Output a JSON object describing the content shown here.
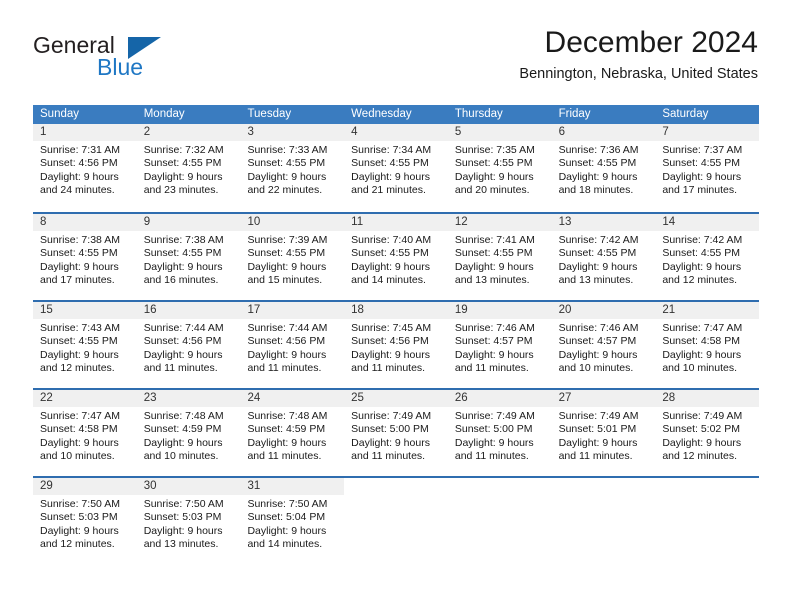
{
  "brand": {
    "name_part1": "General",
    "name_part2": "Blue",
    "triangle_color": "#1565a8",
    "blue_text_color": "#1f77c4"
  },
  "header": {
    "title": "December 2024",
    "location": "Bennington, Nebraska, United States"
  },
  "theme": {
    "header_bar_color": "#3a7cc0",
    "week_divider_color": "#2f6daf",
    "day_number_band_color": "#f0f0f0",
    "text_color": "#1a1a1a"
  },
  "weekdays": [
    "Sunday",
    "Monday",
    "Tuesday",
    "Wednesday",
    "Thursday",
    "Friday",
    "Saturday"
  ],
  "weeks": [
    [
      {
        "day": "1",
        "sunrise": "Sunrise: 7:31 AM",
        "sunset": "Sunset: 4:56 PM",
        "daylight_line1": "Daylight: 9 hours",
        "daylight_line2": "and 24 minutes."
      },
      {
        "day": "2",
        "sunrise": "Sunrise: 7:32 AM",
        "sunset": "Sunset: 4:55 PM",
        "daylight_line1": "Daylight: 9 hours",
        "daylight_line2": "and 23 minutes."
      },
      {
        "day": "3",
        "sunrise": "Sunrise: 7:33 AM",
        "sunset": "Sunset: 4:55 PM",
        "daylight_line1": "Daylight: 9 hours",
        "daylight_line2": "and 22 minutes."
      },
      {
        "day": "4",
        "sunrise": "Sunrise: 7:34 AM",
        "sunset": "Sunset: 4:55 PM",
        "daylight_line1": "Daylight: 9 hours",
        "daylight_line2": "and 21 minutes."
      },
      {
        "day": "5",
        "sunrise": "Sunrise: 7:35 AM",
        "sunset": "Sunset: 4:55 PM",
        "daylight_line1": "Daylight: 9 hours",
        "daylight_line2": "and 20 minutes."
      },
      {
        "day": "6",
        "sunrise": "Sunrise: 7:36 AM",
        "sunset": "Sunset: 4:55 PM",
        "daylight_line1": "Daylight: 9 hours",
        "daylight_line2": "and 18 minutes."
      },
      {
        "day": "7",
        "sunrise": "Sunrise: 7:37 AM",
        "sunset": "Sunset: 4:55 PM",
        "daylight_line1": "Daylight: 9 hours",
        "daylight_line2": "and 17 minutes."
      }
    ],
    [
      {
        "day": "8",
        "sunrise": "Sunrise: 7:38 AM",
        "sunset": "Sunset: 4:55 PM",
        "daylight_line1": "Daylight: 9 hours",
        "daylight_line2": "and 17 minutes."
      },
      {
        "day": "9",
        "sunrise": "Sunrise: 7:38 AM",
        "sunset": "Sunset: 4:55 PM",
        "daylight_line1": "Daylight: 9 hours",
        "daylight_line2": "and 16 minutes."
      },
      {
        "day": "10",
        "sunrise": "Sunrise: 7:39 AM",
        "sunset": "Sunset: 4:55 PM",
        "daylight_line1": "Daylight: 9 hours",
        "daylight_line2": "and 15 minutes."
      },
      {
        "day": "11",
        "sunrise": "Sunrise: 7:40 AM",
        "sunset": "Sunset: 4:55 PM",
        "daylight_line1": "Daylight: 9 hours",
        "daylight_line2": "and 14 minutes."
      },
      {
        "day": "12",
        "sunrise": "Sunrise: 7:41 AM",
        "sunset": "Sunset: 4:55 PM",
        "daylight_line1": "Daylight: 9 hours",
        "daylight_line2": "and 13 minutes."
      },
      {
        "day": "13",
        "sunrise": "Sunrise: 7:42 AM",
        "sunset": "Sunset: 4:55 PM",
        "daylight_line1": "Daylight: 9 hours",
        "daylight_line2": "and 13 minutes."
      },
      {
        "day": "14",
        "sunrise": "Sunrise: 7:42 AM",
        "sunset": "Sunset: 4:55 PM",
        "daylight_line1": "Daylight: 9 hours",
        "daylight_line2": "and 12 minutes."
      }
    ],
    [
      {
        "day": "15",
        "sunrise": "Sunrise: 7:43 AM",
        "sunset": "Sunset: 4:55 PM",
        "daylight_line1": "Daylight: 9 hours",
        "daylight_line2": "and 12 minutes."
      },
      {
        "day": "16",
        "sunrise": "Sunrise: 7:44 AM",
        "sunset": "Sunset: 4:56 PM",
        "daylight_line1": "Daylight: 9 hours",
        "daylight_line2": "and 11 minutes."
      },
      {
        "day": "17",
        "sunrise": "Sunrise: 7:44 AM",
        "sunset": "Sunset: 4:56 PM",
        "daylight_line1": "Daylight: 9 hours",
        "daylight_line2": "and 11 minutes."
      },
      {
        "day": "18",
        "sunrise": "Sunrise: 7:45 AM",
        "sunset": "Sunset: 4:56 PM",
        "daylight_line1": "Daylight: 9 hours",
        "daylight_line2": "and 11 minutes."
      },
      {
        "day": "19",
        "sunrise": "Sunrise: 7:46 AM",
        "sunset": "Sunset: 4:57 PM",
        "daylight_line1": "Daylight: 9 hours",
        "daylight_line2": "and 11 minutes."
      },
      {
        "day": "20",
        "sunrise": "Sunrise: 7:46 AM",
        "sunset": "Sunset: 4:57 PM",
        "daylight_line1": "Daylight: 9 hours",
        "daylight_line2": "and 10 minutes."
      },
      {
        "day": "21",
        "sunrise": "Sunrise: 7:47 AM",
        "sunset": "Sunset: 4:58 PM",
        "daylight_line1": "Daylight: 9 hours",
        "daylight_line2": "and 10 minutes."
      }
    ],
    [
      {
        "day": "22",
        "sunrise": "Sunrise: 7:47 AM",
        "sunset": "Sunset: 4:58 PM",
        "daylight_line1": "Daylight: 9 hours",
        "daylight_line2": "and 10 minutes."
      },
      {
        "day": "23",
        "sunrise": "Sunrise: 7:48 AM",
        "sunset": "Sunset: 4:59 PM",
        "daylight_line1": "Daylight: 9 hours",
        "daylight_line2": "and 10 minutes."
      },
      {
        "day": "24",
        "sunrise": "Sunrise: 7:48 AM",
        "sunset": "Sunset: 4:59 PM",
        "daylight_line1": "Daylight: 9 hours",
        "daylight_line2": "and 11 minutes."
      },
      {
        "day": "25",
        "sunrise": "Sunrise: 7:49 AM",
        "sunset": "Sunset: 5:00 PM",
        "daylight_line1": "Daylight: 9 hours",
        "daylight_line2": "and 11 minutes."
      },
      {
        "day": "26",
        "sunrise": "Sunrise: 7:49 AM",
        "sunset": "Sunset: 5:00 PM",
        "daylight_line1": "Daylight: 9 hours",
        "daylight_line2": "and 11 minutes."
      },
      {
        "day": "27",
        "sunrise": "Sunrise: 7:49 AM",
        "sunset": "Sunset: 5:01 PM",
        "daylight_line1": "Daylight: 9 hours",
        "daylight_line2": "and 11 minutes."
      },
      {
        "day": "28",
        "sunrise": "Sunrise: 7:49 AM",
        "sunset": "Sunset: 5:02 PM",
        "daylight_line1": "Daylight: 9 hours",
        "daylight_line2": "and 12 minutes."
      }
    ],
    [
      {
        "day": "29",
        "sunrise": "Sunrise: 7:50 AM",
        "sunset": "Sunset: 5:03 PM",
        "daylight_line1": "Daylight: 9 hours",
        "daylight_line2": "and 12 minutes."
      },
      {
        "day": "30",
        "sunrise": "Sunrise: 7:50 AM",
        "sunset": "Sunset: 5:03 PM",
        "daylight_line1": "Daylight: 9 hours",
        "daylight_line2": "and 13 minutes."
      },
      {
        "day": "31",
        "sunrise": "Sunrise: 7:50 AM",
        "sunset": "Sunset: 5:04 PM",
        "daylight_line1": "Daylight: 9 hours",
        "daylight_line2": "and 14 minutes."
      },
      {
        "day": "",
        "sunrise": "",
        "sunset": "",
        "daylight_line1": "",
        "daylight_line2": ""
      },
      {
        "day": "",
        "sunrise": "",
        "sunset": "",
        "daylight_line1": "",
        "daylight_line2": ""
      },
      {
        "day": "",
        "sunrise": "",
        "sunset": "",
        "daylight_line1": "",
        "daylight_line2": ""
      },
      {
        "day": "",
        "sunrise": "",
        "sunset": "",
        "daylight_line1": "",
        "daylight_line2": ""
      }
    ]
  ]
}
